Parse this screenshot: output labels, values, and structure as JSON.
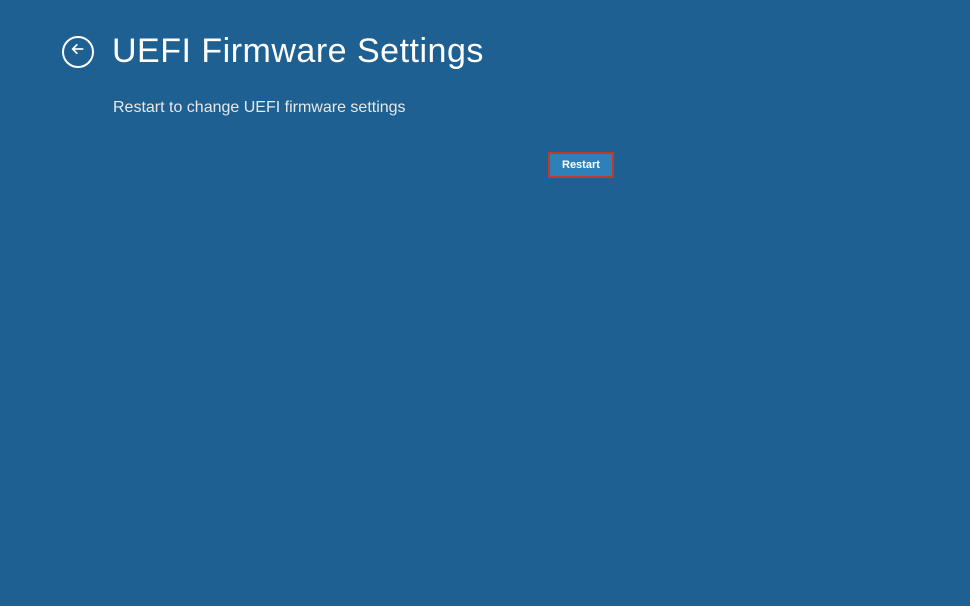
{
  "header": {
    "title": "UEFI Firmware Settings"
  },
  "body": {
    "description": "Restart to change UEFI firmware settings",
    "restart_button_label": "Restart"
  },
  "colors": {
    "background": "#1e6091",
    "button_bg": "#2d81b8",
    "highlight_border": "#c0392b"
  }
}
